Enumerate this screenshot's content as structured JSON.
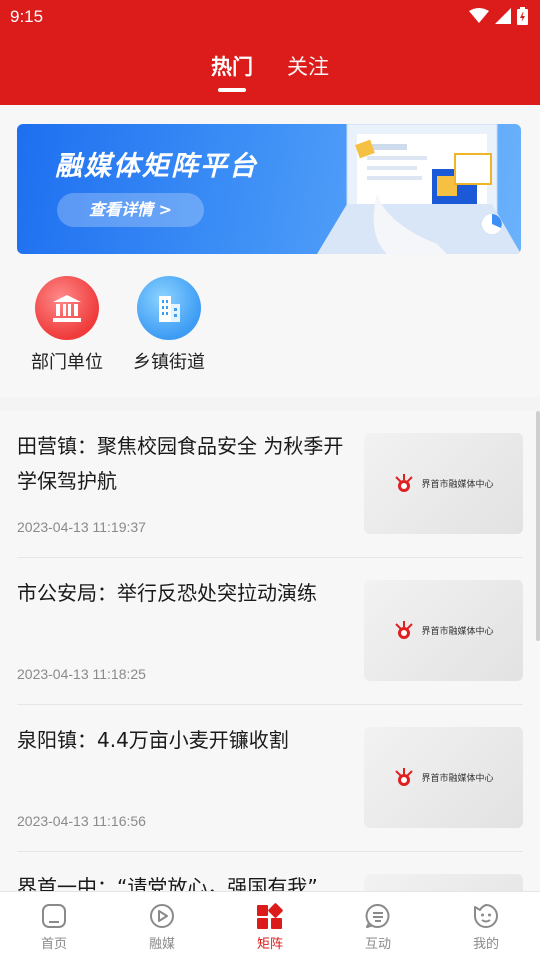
{
  "status_bar": {
    "time": "9:15"
  },
  "top_tabs": [
    {
      "label": "热门",
      "active": true
    },
    {
      "label": "关注",
      "active": false
    }
  ],
  "banner": {
    "title": "融媒体矩阵平台",
    "button_label": "查看详情 >"
  },
  "entries": [
    {
      "label": "部门单位",
      "icon": "building-institution-icon",
      "color": "#ef3b3b"
    },
    {
      "label": "乡镇街道",
      "icon": "city-buildings-icon",
      "color": "#3d9cf4"
    }
  ],
  "news": [
    {
      "title": "田营镇：聚焦校园食品安全 为秋季开学保驾护航",
      "time": "2023-04-13 11:19:37",
      "thumb_text": "界首市融媒体中心"
    },
    {
      "title": "市公安局：举行反恐处突拉动演练",
      "time": "2023-04-13 11:18:25",
      "thumb_text": "界首市融媒体中心"
    },
    {
      "title": "泉阳镇：4.4万亩小麦开镰收割",
      "time": "2023-04-13 11:16:56",
      "thumb_text": "界首市融媒体中心"
    },
    {
      "title": "界首一中：“请党放心，强国有我”",
      "time": "",
      "thumb_text": ""
    }
  ],
  "bottom_nav": [
    {
      "label": "首页",
      "icon": "home-icon",
      "active": false
    },
    {
      "label": "融媒",
      "icon": "play-icon",
      "active": false
    },
    {
      "label": "矩阵",
      "icon": "matrix-grid-icon",
      "active": true
    },
    {
      "label": "互动",
      "icon": "chat-icon",
      "active": false
    },
    {
      "label": "我的",
      "icon": "profile-face-icon",
      "active": false
    }
  ],
  "colors": {
    "brand_red": "#dc1b1b",
    "banner_blue": "#1e6ff0",
    "inactive_gray": "#8a8a8a"
  }
}
